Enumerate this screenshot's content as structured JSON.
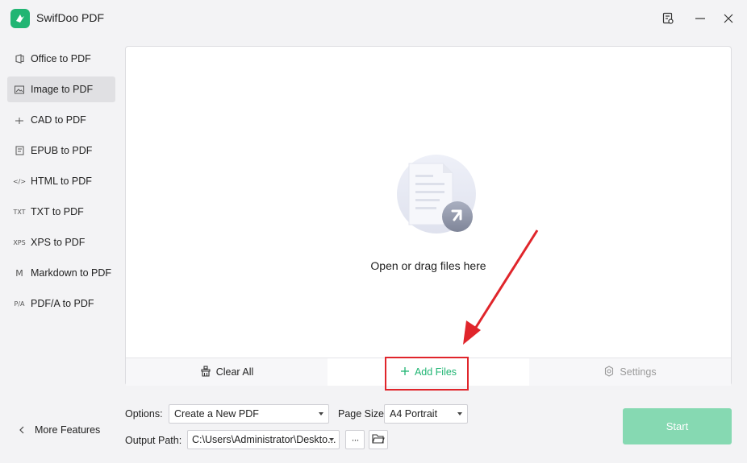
{
  "app": {
    "title": "SwifDoo PDF"
  },
  "window_controls": {
    "feedback_icon": "feedback-icon",
    "minimize_icon": "minimize-icon",
    "close_icon": "close-icon"
  },
  "sidebar": {
    "items": [
      {
        "label": "Office to PDF",
        "icon": "office-icon",
        "active": false
      },
      {
        "label": "Image to PDF",
        "icon": "image-icon",
        "active": true
      },
      {
        "label": "CAD to PDF",
        "icon": "cad-icon",
        "active": false
      },
      {
        "label": "EPUB to PDF",
        "icon": "epub-icon",
        "active": false
      },
      {
        "label": "HTML to PDF",
        "icon": "html-icon",
        "active": false,
        "glyph": "</>"
      },
      {
        "label": "TXT to PDF",
        "icon": "txt-icon",
        "active": false,
        "glyph": "TXT"
      },
      {
        "label": "XPS to PDF",
        "icon": "xps-icon",
        "active": false,
        "glyph": "XPS"
      },
      {
        "label": "Markdown to PDF",
        "icon": "markdown-icon",
        "active": false,
        "glyph": "M"
      },
      {
        "label": "PDF/A to PDF",
        "icon": "pdfa-icon",
        "active": false,
        "glyph": "P/A"
      }
    ],
    "more_features": "More Features"
  },
  "drop_area": {
    "prompt": "Open or drag files here"
  },
  "actions": {
    "clear_all": "Clear All",
    "add_files": "Add Files",
    "settings": "Settings"
  },
  "options": {
    "options_label": "Options:",
    "options_value": "Create a New PDF",
    "page_size_label": "Page Size:",
    "page_size_value": "A4 Portrait",
    "output_path_label": "Output Path:",
    "output_path_value": "C:\\Users\\Administrator\\Deskto...",
    "more_glyph": "···"
  },
  "start": {
    "label": "Start"
  },
  "colors": {
    "accent": "#21b573",
    "start_button": "#86d9b2",
    "annotation": "#e0252b"
  }
}
